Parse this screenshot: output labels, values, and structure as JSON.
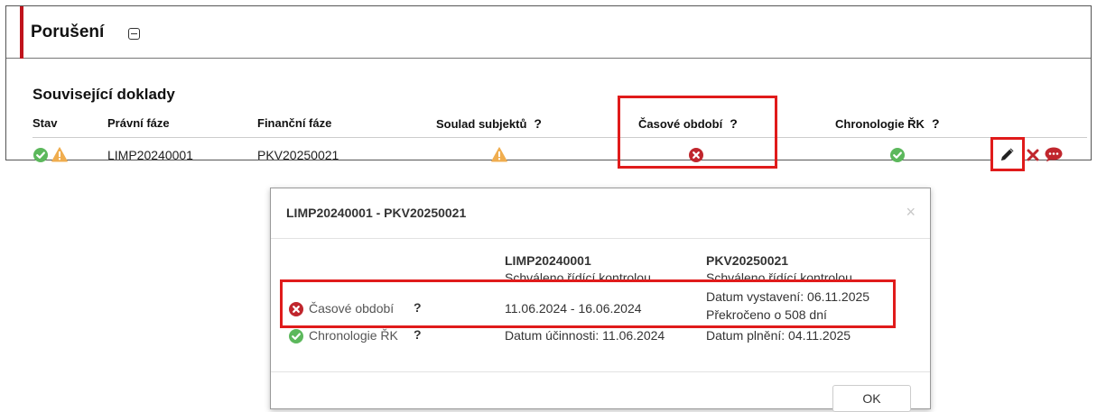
{
  "panel": {
    "title": "Porušení",
    "section_title": "Související doklady",
    "columns": {
      "stav": "Stav",
      "pravni_faze": "Právní fáze",
      "financni_faze": "Finanční fáze",
      "soulad_subjektu": "Soulad subjektů",
      "casove_obdobi": "Časové období",
      "chronologie_rk": "Chronologie ŘK",
      "help_mark": "?"
    },
    "row": {
      "pravni_faze": "LIMP20240001",
      "financni_faze": "PKV20250021"
    }
  },
  "colors": {
    "success": "#5cb85c",
    "warning": "#f0ad4e",
    "danger": "#c0262d",
    "highlight": "#e01b1b",
    "accent": "#c0141c"
  },
  "icons": [
    "check-circle-icon",
    "warning-triangle-icon",
    "x-circle-icon",
    "pencil-icon",
    "close-x-icon",
    "comment-icon",
    "help-icon",
    "collapse-minus-icon"
  ],
  "dialog": {
    "title": "LIMP20240001 - PKV20250021",
    "close_glyph": "×",
    "col1": {
      "header": "LIMP20240001",
      "status": "Schváleno řídící kontrolou"
    },
    "col2": {
      "header": "PKV20250021",
      "status": "Schváleno řídící kontrolou"
    },
    "rows": [
      {
        "label": "Časové období",
        "help": "?",
        "value1": "11.06.2024 - 16.06.2024",
        "value2_line1": "Datum vystavení: 06.11.2025",
        "value2_line2": "Překročeno o 508 dní"
      },
      {
        "label": "Chronologie ŘK",
        "help": "?",
        "value1": "Datum účinnosti: 11.06.2024",
        "value2_line1": "Datum plnění: 04.11.2025"
      }
    ],
    "ok_label": "OK"
  }
}
